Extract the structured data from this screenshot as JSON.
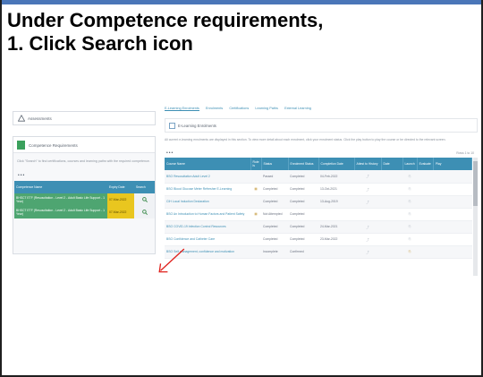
{
  "instruction": {
    "line1": "Under Competence requirements,",
    "line2": "1. Click Search icon"
  },
  "colors": {
    "accent_blue": "#3d8fb4",
    "green_row": "#4ea571",
    "yellow_date": "#e9c61f",
    "arrow_red": "#e0211c",
    "top_strip": "#4a76b8"
  },
  "left_panel": {
    "assessments_title": "Assessments",
    "competence_title": "Competence Requirements",
    "description": "Click \"Search\" to find certifications, courses and learning paths with the required competence.",
    "dots": "•••",
    "table": {
      "headers": [
        "Competence Name",
        "Expiry Date",
        "Search"
      ],
      "rows": [
        {
          "name": "BHSCT ETF (Resuscitation - Level 2 - Adult Basic Life Support - 1 Year)",
          "date": "07-Mar-2022",
          "icon": "search-icon"
        },
        {
          "name": "BHSCT ETF (Resuscitation - Level 2 - Adult Basic Life Support - 1 Year)",
          "date": "07-Mar-2022",
          "icon": "search-icon"
        }
      ]
    }
  },
  "right_panel": {
    "tabs": [
      "E-Learning Enrolments",
      "Enrolments",
      "Certifications",
      "Learning Paths",
      "External Learning"
    ],
    "active_tab": 0,
    "section_title": "E-Learning Enrolments",
    "description": "All current e-learning enrolments are displayed in this section. To view more detail about each enrolment, click your enrolment status. Click the play button to play the course or be directed to the relevant screen.",
    "dots": "•••",
    "count": "Rows 1 to 10",
    "table": {
      "headers": [
        "Course Name",
        "Role ls",
        "Status",
        "Enrolment Status",
        "Completion Date",
        "Attest to History",
        "Date",
        "Launch",
        "Evaluate",
        "Play"
      ],
      "rows": [
        {
          "course": "BSO Resuscitation Adult Level 2",
          "status": "Passed",
          "enrolment": "Completed",
          "date": "04-Feb-2022"
        },
        {
          "course": "BSO Blood Glucose Meter Refresher E-Learning",
          "status": "Completed",
          "enrolment": "Completed",
          "date": "13-Oct-2021"
        },
        {
          "course": "CIH Local Induction Declaration",
          "status": "Completed",
          "enrolment": "Completed",
          "date": "13-Aug-2019"
        },
        {
          "course": "BSO An Introduction to Human Factors and Patient Safety",
          "status": "Not Attempted",
          "enrolment": "Completed",
          "date": ""
        },
        {
          "course": "BSO COVID-19 Infection Control Resources",
          "status": "Completed",
          "enrolment": "Completed",
          "date": "24-Mar-2021"
        },
        {
          "course": "BSO Confidence and Catheter Care",
          "status": "Completed",
          "enrolment": "Completed",
          "date": "23-Mar-2022"
        },
        {
          "course": "BSO Self management, confidence and motivation",
          "status": "Incomplete",
          "enrolment": "Confirmed",
          "date": ""
        }
      ]
    }
  }
}
